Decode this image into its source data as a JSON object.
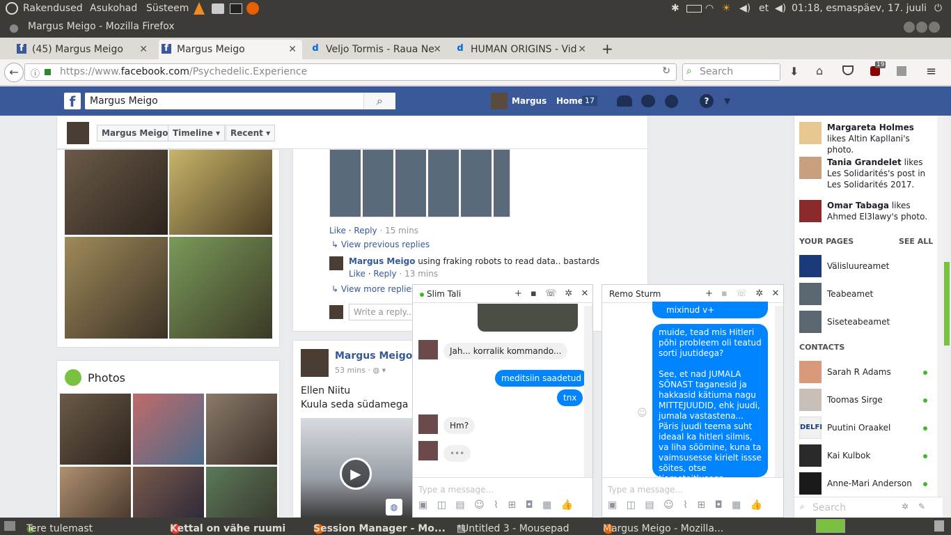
{
  "system_bar": {
    "menus": [
      "Rakendused",
      "Asukohad",
      "Süsteem"
    ],
    "lang": "et",
    "clock": "01:18, esmaspäev, 17. juuli"
  },
  "window_title": "Margus Meigo - Mozilla Firefox",
  "tabs": [
    {
      "label": "(45) Margus Meigo"
    },
    {
      "label": "Margus Meigo"
    },
    {
      "label": "Veljo Tormis - Raua Ne"
    },
    {
      "label": "HUMAN ORIGINS - Vid"
    }
  ],
  "url": {
    "prefix": "https://www.",
    "domain": "facebook.com",
    "path": "/Psychedelic.Experience"
  },
  "search_placeholder": "Search",
  "addon_badge": "19",
  "fb": {
    "search_value": "Margus Meigo",
    "user": "Margus",
    "home": "Home",
    "home_count": "17"
  },
  "profile_nav": {
    "name": "Margus Meigo",
    "timeline": "Timeline",
    "recent": "Recent"
  },
  "photos_title": "Photos",
  "comments": {
    "like": "Like",
    "reply": "Reply",
    "time1": "· 15 mins",
    "view_prev": "View previous replies",
    "author": "Margus Meigo",
    "text": "using fraking robots to read data.. bastards",
    "time2": "· 13 mins",
    "view_more": "View more replies",
    "write_placeholder": "Write a reply..."
  },
  "post": {
    "author": "Margus Meigo",
    "time": "53 mins ·",
    "line1": "Ellen Niitu",
    "line2": "Kuula seda südamega"
  },
  "chat1": {
    "name": "Slim Tali",
    "messages": [
      {
        "side": "left",
        "text": "Jah... korralik kommando..."
      },
      {
        "side": "right",
        "text": "meditsiin saadetud"
      },
      {
        "side": "right",
        "text": "tnx"
      },
      {
        "side": "left",
        "text": "Hm?"
      },
      {
        "side": "left",
        "text": "•••"
      }
    ],
    "placeholder": "Type a message..."
  },
  "chat2": {
    "name": "Remo Sturm",
    "top_text": "mixinud v+",
    "bubble_text": "muide, tead mis Hitleri põhi probleem oli teatud sorti juutidega?\n\nSee, et nad JUMALA SÕNAST taganesid ja hakkasid kätiuma nagu MITTEJUUDID, ehk juudi, jumala vastastena...\nPäris juudi teema suht ideaal ka hitleri silmis, va liha söömine, kuna ta vaimsusesse kirielt issse sõites, otse tiametoitlusega",
    "placeholder": "Type a message..."
  },
  "ticker": [
    {
      "name": "Margareta Holmes",
      "rest": "likes Altin Kapllani's photo."
    },
    {
      "name": "Tania Grandelet",
      "rest": "likes Les Solidarités's post in Les Solidarités 2017."
    },
    {
      "name": "Omar Tabaga",
      "rest": "likes Ahmed El3lawy's photo."
    }
  ],
  "your_pages": {
    "title": "YOUR PAGES",
    "see_all": "SEE ALL",
    "items": [
      "Välisluureamet",
      "Teabeamet",
      "Siseteabeamet"
    ]
  },
  "contacts": {
    "title": "CONTACTS",
    "items": [
      "Sarah R Adams",
      "Toomas Sirge",
      "Puutini Oraakel",
      "Kai Kulbok",
      "Anne-Mari Anderson"
    ]
  },
  "sidebar_search": "Search",
  "taskbar": [
    "Tere tulemast",
    "Kettal on vähe ruumi",
    "Session Manager - Mo...",
    "*Untitled 3 - Mousepad",
    "Margus Meigo - Mozilla..."
  ],
  "colors": {
    "fb_blue": "#3b5998",
    "messenger_blue": "#0084ff",
    "online": "#42b72a"
  }
}
